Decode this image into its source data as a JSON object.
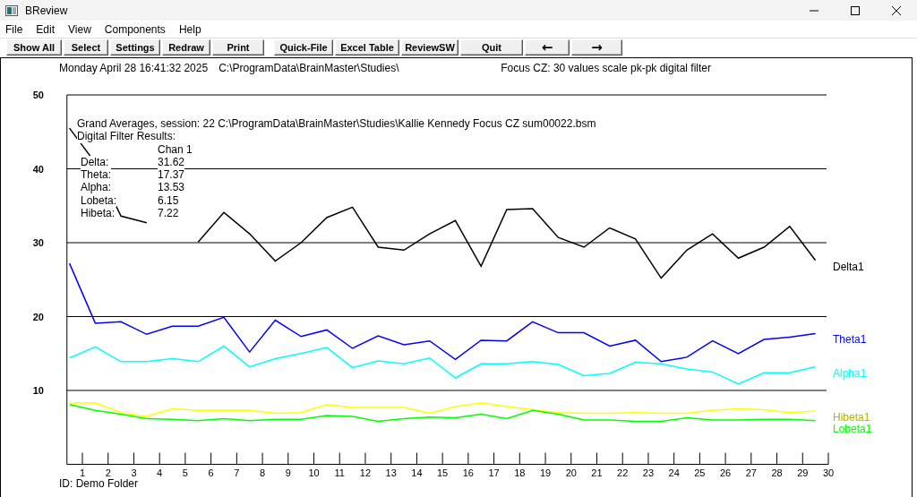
{
  "window": {
    "title": "BReview"
  },
  "menu": [
    "File",
    "Edit",
    "View",
    "Components",
    "Help"
  ],
  "toolbar": {
    "groups": [
      [
        "Show All",
        "Select",
        "Settings",
        "Redraw",
        "Print"
      ],
      [
        "Quick-File",
        "Excel Table",
        "ReviewSW",
        "Quit",
        "←",
        "→"
      ]
    ]
  },
  "header": {
    "date": "Monday April 28 16:41:32 2025",
    "path": "C:\\ProgramData\\BrainMaster\\Studies\\",
    "description": "Focus CZ: 30 values scale pk-pk digital filter"
  },
  "results": {
    "title": "Grand Averages, session: 22 C:\\ProgramData\\BrainMaster\\Studies\\Kallie Kennedy Focus CZ sum00022.bsm",
    "subtitle": "Digital Filter Results:",
    "column": "Chan 1",
    "rows": [
      {
        "label": "Delta:",
        "value": "31.62"
      },
      {
        "label": "Theta:",
        "value": "17.37"
      },
      {
        "label": "Alpha:",
        "value": "13.53"
      },
      {
        "label": "Lobeta:",
        "value": "6.15"
      },
      {
        "label": "Hibeta:",
        "value": "7.22"
      }
    ]
  },
  "chart_data": {
    "type": "line",
    "x": [
      0.5,
      1.5,
      2.5,
      3.5,
      4.5,
      5.5,
      6.5,
      7.5,
      8.5,
      9.5,
      10.5,
      11.5,
      12.5,
      13.5,
      14.5,
      15.5,
      16.5,
      17.5,
      18.5,
      19.5,
      20.5,
      21.5,
      22.5,
      23.5,
      24.5,
      25.5,
      26.5,
      27.5,
      28.5,
      29.5
    ],
    "xlim": [
      0.4,
      30
    ],
    "grid": true,
    "ylim": [
      0,
      50
    ],
    "xticks": [
      1,
      2,
      3,
      4,
      5,
      6,
      7,
      8,
      9,
      10,
      11,
      12,
      13,
      14,
      15,
      16,
      17,
      18,
      19,
      20,
      21,
      22,
      23,
      24,
      25,
      26,
      27,
      28,
      29,
      30
    ],
    "yticks": [
      10,
      20,
      30,
      40,
      50
    ],
    "series": [
      {
        "name": "Delta1",
        "color": "#000000",
        "values": [
          45.5,
          40.8,
          33.6,
          32.7,
          null,
          30.1,
          34.1,
          31.2,
          27.5,
          30,
          33.4,
          34.8,
          29.4,
          29,
          31.2,
          33,
          26.8,
          34.5,
          34.6,
          30.7,
          29.4,
          32,
          30.5,
          25.2,
          29,
          31.2,
          27.9,
          29.4,
          32.2,
          27.6
        ]
      },
      {
        "name": "Theta1",
        "color": "#0000ff",
        "values": [
          27.2,
          19.1,
          19.3,
          17.6,
          18.7,
          18.7,
          19.9,
          15.2,
          19.5,
          17.3,
          18.2,
          15.7,
          17.4,
          16.2,
          16.7,
          14.2,
          16.8,
          16.7,
          19.3,
          17.8,
          17.8,
          16,
          16.8,
          13.9,
          14.5,
          16.7,
          15,
          16.9,
          17.2,
          17.7
        ]
      },
      {
        "name": "Alpha1",
        "color": "#00ffff",
        "values": [
          14.4,
          15.9,
          13.9,
          13.9,
          14.3,
          13.9,
          16,
          13.2,
          14.3,
          15,
          15.8,
          13.1,
          14,
          13.6,
          14.4,
          11.7,
          13.6,
          13.6,
          13.9,
          13.5,
          12,
          12.3,
          13.8,
          13.6,
          12.9,
          12.5,
          10.9,
          12.4,
          12.4,
          13.2
        ]
      },
      {
        "name": "Hibeta1",
        "color": "#ffff00",
        "values": [
          8.3,
          8.3,
          7,
          6.5,
          7.5,
          7.3,
          7.3,
          7.3,
          6.9,
          7,
          8.1,
          7.7,
          7.7,
          7.7,
          6.9,
          7.8,
          8.3,
          7.8,
          7.4,
          7,
          6.9,
          6.9,
          7,
          6.9,
          6.9,
          7.3,
          7.5,
          7.4,
          7,
          7.2
        ]
      },
      {
        "name": "Lobeta1",
        "color": "#00ff00",
        "values": [
          8.1,
          7.3,
          6.8,
          6.2,
          6.1,
          5.9,
          6.2,
          5.9,
          6.1,
          6.1,
          6.6,
          6.5,
          5.8,
          6.2,
          6.4,
          6.3,
          6.8,
          6.2,
          7.3,
          6.8,
          6,
          6,
          5.8,
          5.8,
          6.3,
          6,
          6,
          6.1,
          6.1,
          5.9
        ]
      }
    ]
  },
  "footer": "ID: Demo Folder"
}
